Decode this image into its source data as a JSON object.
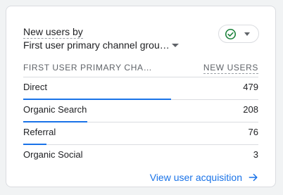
{
  "card": {
    "title_line1": "New users by",
    "title_line2": "First user primary channel grou…",
    "status_icon": "check-circle-icon",
    "status_color": "#188038",
    "columns": {
      "dimension": "FIRST USER PRIMARY CHA…",
      "metric": "NEW USERS"
    },
    "rows": [
      {
        "label": "Direct",
        "value": "479",
        "share": 1.0
      },
      {
        "label": "Organic Search",
        "value": "208",
        "share": 0.434
      },
      {
        "label": "Referral",
        "value": "76",
        "share": 0.159
      },
      {
        "label": "Organic Social",
        "value": "3",
        "share": 0.006
      }
    ],
    "footer_link": "View user acquisition",
    "accent_color": "#1a73e8"
  }
}
